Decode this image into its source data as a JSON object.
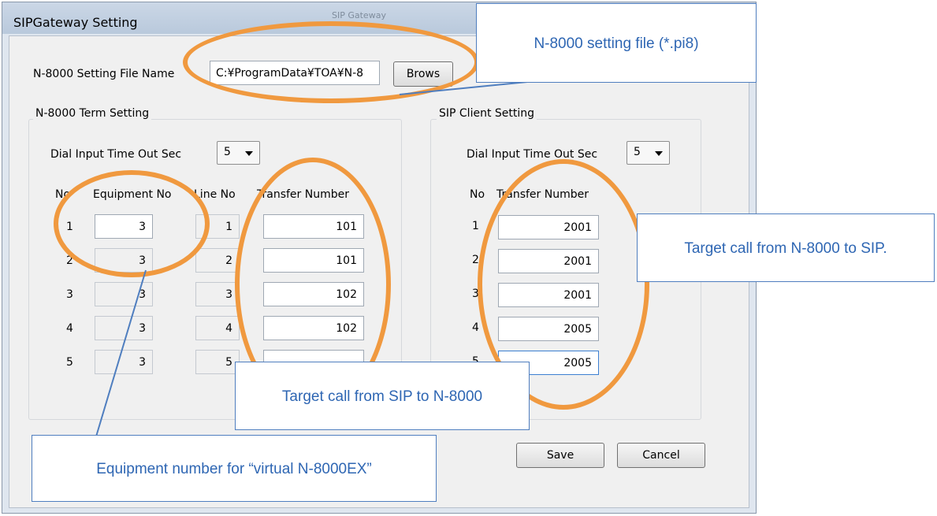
{
  "window": {
    "title": "SIPGateway Setting",
    "background_title": "SIP Gateway"
  },
  "file_setting": {
    "label": "N-8000 Setting File Name",
    "value": "C:¥ProgramData¥TOA¥N-8",
    "browse_label": "Brows"
  },
  "term_setting": {
    "group_label": "N-8000 Term Setting",
    "dial_label": "Dial Input Time Out Sec",
    "dial_value": "5",
    "headers": {
      "no": "No",
      "equipment": "Equipment No",
      "line": "Line No",
      "transfer": "Transfer Number"
    },
    "rows": [
      {
        "no": "1",
        "equipment": "3",
        "line": "1",
        "transfer": "101"
      },
      {
        "no": "2",
        "equipment": "3",
        "line": "2",
        "transfer": "101"
      },
      {
        "no": "3",
        "equipment": "3",
        "line": "3",
        "transfer": "102"
      },
      {
        "no": "4",
        "equipment": "3",
        "line": "4",
        "transfer": "102"
      },
      {
        "no": "5",
        "equipment": "3",
        "line": "5",
        "transfer": ""
      }
    ]
  },
  "sip_setting": {
    "group_label": "SIP Client Setting",
    "dial_label": "Dial Input Time Out Sec",
    "dial_value": "5",
    "headers": {
      "no": "No",
      "transfer": "Transfer Number"
    },
    "rows": [
      {
        "no": "1",
        "transfer": "2001"
      },
      {
        "no": "2",
        "transfer": "2001"
      },
      {
        "no": "3",
        "transfer": "2001"
      },
      {
        "no": "4",
        "transfer": "2005"
      },
      {
        "no": "5",
        "transfer": "2005"
      }
    ]
  },
  "buttons": {
    "save": "Save",
    "cancel": "Cancel"
  },
  "annotations": {
    "file": "N-8000 setting file (*.pi8)",
    "sip_target": "Target call from N-8000 to SIP.",
    "n8000_target": "Target call from SIP to N-8000",
    "equipment": "Equipment number for “virtual N-8000EX”"
  },
  "colors": {
    "annotation_orange": "#f0993f",
    "callout_blue": "#2e66b3",
    "callout_border": "#4f7ebf"
  }
}
